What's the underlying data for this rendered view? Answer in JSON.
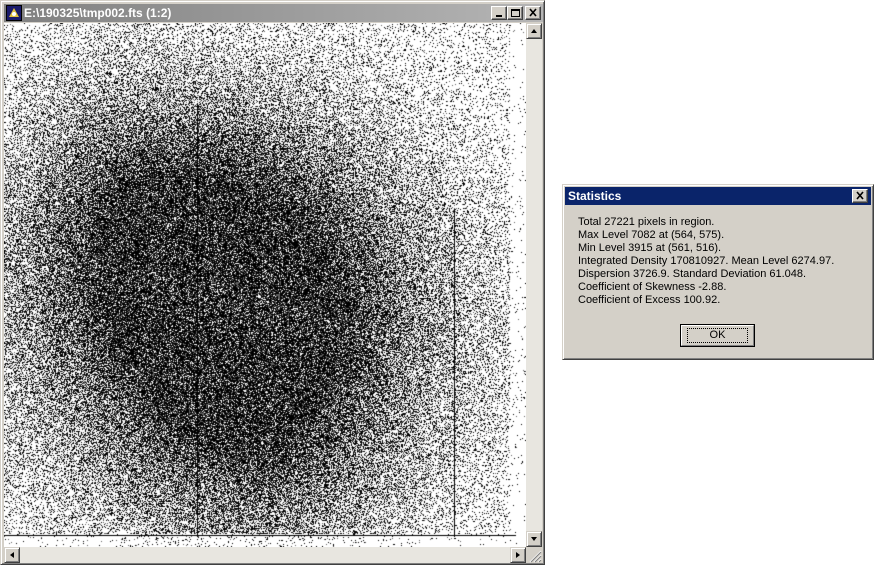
{
  "image_window": {
    "title": "E:\\190325\\tmp002.fts (1:2)",
    "icon": "app-logo-icon",
    "controls": [
      "minimize-icon",
      "maximize-icon",
      "close-icon"
    ]
  },
  "statistics_dialog": {
    "title": "Statistics",
    "lines": [
      "Total 27221 pixels in region.",
      "Max Level 7082 at (564, 575).",
      "Min Level 3915 at (561, 516).",
      "Integrated Density 170810927. Mean Level 6274.97.",
      "Dispersion 3726.9. Standard Deviation 61.048.",
      "Coefficient of Skewness -2.88.",
      "Coefficient of Excess 100.92."
    ],
    "ok_label": "OK"
  },
  "colors": {
    "dialog_title_active": "#0a246a",
    "window_title_inactive": "#808080",
    "face": "#d4d0c8"
  }
}
